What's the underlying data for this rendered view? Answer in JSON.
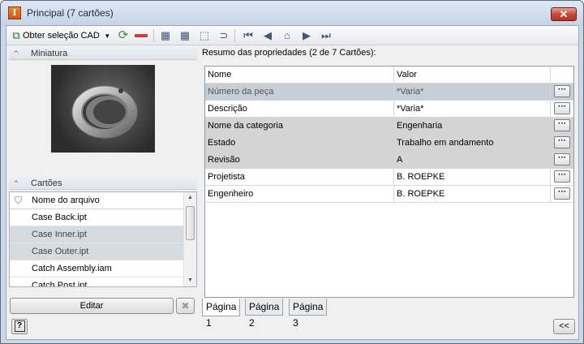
{
  "window": {
    "title": "Principal (7 cartões)",
    "close_glyph": "✕",
    "app_icon_letter": "I"
  },
  "toolbar": {
    "get_cad_label": "Obter seleção CAD",
    "get_cad_dropdown": "▾",
    "icons": [
      "refresh-icon",
      "remove-icon",
      "view-1-icon",
      "view-2-icon",
      "select-icon",
      "link-icon",
      "nav-first-icon",
      "nav-prev-icon",
      "home-icon",
      "nav-next-icon",
      "nav-last-icon"
    ]
  },
  "left": {
    "thumbnail_title": "Miniatura",
    "cards_title": "Cartões",
    "list_header": "Nome do arquivo",
    "files": [
      {
        "name": "Case Back.ipt",
        "selected": false
      },
      {
        "name": "Case Inner.ipt",
        "selected": true
      },
      {
        "name": "Case Outer.ipt",
        "selected": true
      },
      {
        "name": "Catch Assembly.iam",
        "selected": false
      },
      {
        "name": "Catch Post.ipt",
        "selected": false
      }
    ],
    "edit_label": "Editar",
    "delete_glyph": "✖"
  },
  "summary": {
    "title": "Resumo das propriedades (2 de 7 Cartões):",
    "col_name": "Nome",
    "col_value": "Valor",
    "rows": [
      {
        "name": "Número da peça",
        "value": "*Varia*"
      },
      {
        "name": "Descrição",
        "value": "*Varia*"
      },
      {
        "name": "Nome da categoria",
        "value": "Engenharia"
      },
      {
        "name": "Estado",
        "value": "Trabalho em andamento"
      },
      {
        "name": "Revisão",
        "value": "A"
      },
      {
        "name": "Projetista",
        "value": "B. ROEPKE"
      },
      {
        "name": "Engenheiro",
        "value": "B. ROEPKE"
      }
    ],
    "ellipsis": "···"
  },
  "tabs": [
    "Página 1",
    "Página 2",
    "Página 3"
  ],
  "footer": {
    "help_glyph": "?",
    "collapse_label": "<<"
  }
}
